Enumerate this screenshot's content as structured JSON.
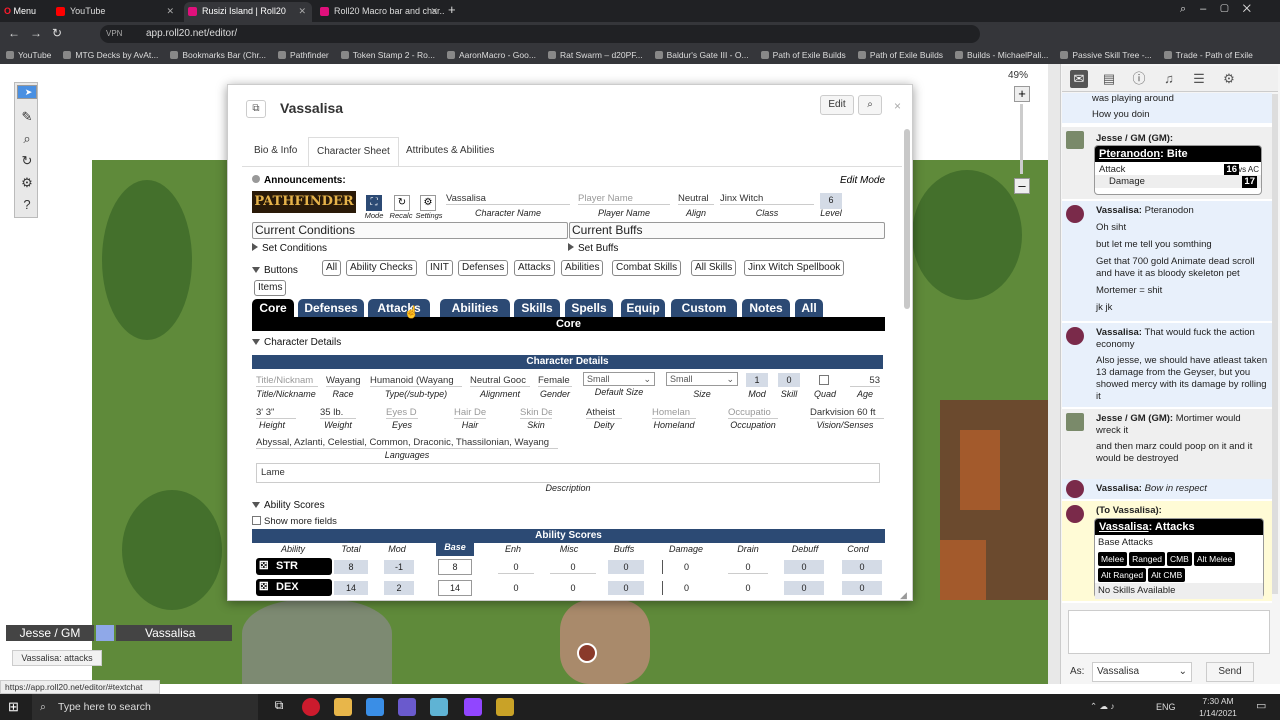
{
  "browser": {
    "menu_label": "Menu",
    "tabs": [
      {
        "label": "YouTube",
        "color": "#ff0000",
        "active": false
      },
      {
        "label": "Rusizi Island | Roll20",
        "color": "#e0107c",
        "active": true
      },
      {
        "label": "Roll20 Macro bar and char...",
        "color": "#e0107c",
        "active": false
      }
    ],
    "url": "app.roll20.net/editor/",
    "vpn_label": "VPN",
    "bookmarks": [
      "YouTube",
      "MTG Decks by AvAt...",
      "Bookmarks Bar (Chr...",
      "Pathfinder",
      "Token Stamp 2 - Ro...",
      "AaronMacro - Goo...",
      "Rat Swarm – d20PF...",
      "Baldur's Gate III - O...",
      "Path of Exile Builds",
      "Path of Exile Builds",
      "Builds - MichaelPali...",
      "Passive Skill Tree -...",
      "Trade - Path of Exile"
    ],
    "zoom": "49%",
    "status_url": "https://app.roll20.net/editor/#textchat"
  },
  "dialog": {
    "title": "Vassalisa",
    "edit_label": "Edit",
    "sheet_tabs": [
      "Bio & Info",
      "Character Sheet",
      "Attributes & Abilities"
    ],
    "announcements_label": "Announcements:",
    "edit_mode_label": "Edit Mode",
    "logo_text": "PATHFINDER",
    "icon_labels": {
      "mode": "Mode",
      "recalc": "Recalc",
      "settings": "Settings"
    },
    "header_fields": {
      "character_name": "Vassalisa",
      "character_name_label": "Character Name",
      "player_name_placeholder": "Player Name",
      "player_name_label": "Player Name",
      "align": "Neutral",
      "align_label": "Align",
      "class": "Jinx Witch",
      "class_label": "Class",
      "level": "6",
      "level_label": "Level"
    },
    "current_conditions": "Current Conditions",
    "current_buffs": "Current Buffs",
    "set_conditions": "Set Conditions",
    "set_buffs": "Set Buffs",
    "buttons_label": "Buttons",
    "buttons": [
      "All",
      "Ability Checks",
      "INIT",
      "Defenses",
      "Attacks",
      "Abilities",
      "Combat Skills",
      "All Skills",
      "Jinx Witch Spellbook",
      "Items"
    ],
    "core_tabs": [
      "Core",
      "Defenses",
      "Attacks",
      "Abilities",
      "Skills",
      "Spells",
      "Equip",
      "Custom",
      "Notes",
      "All"
    ],
    "core_header": "Core",
    "character_details_toggle": "Character Details",
    "character_details_header": "Character Details",
    "details_row1": [
      {
        "value": "Title/Nicknam",
        "label": "Title/Nickname",
        "placeholder": true
      },
      {
        "value": "Wayang",
        "label": "Race"
      },
      {
        "value": "Humanoid (Wayang",
        "label": "Type(/sub-type)"
      },
      {
        "value": "Neutral Gooc",
        "label": "Alignment"
      },
      {
        "value": "Female",
        "label": "Gender"
      }
    ],
    "default_size": {
      "value": "Small",
      "label": "Default Size"
    },
    "size": {
      "value": "Small",
      "label": "Size"
    },
    "mod": {
      "value": "1",
      "label": "Mod"
    },
    "skill": {
      "value": "0",
      "label": "Skill"
    },
    "quad_label": "Quad",
    "age": {
      "value": "53",
      "label": "Age"
    },
    "details_row2": [
      {
        "value": "3' 3\"",
        "label": "Height"
      },
      {
        "value": "35 lb.",
        "label": "Weight"
      },
      {
        "value": "Eyes D",
        "label": "Eyes",
        "placeholder": true
      },
      {
        "value": "Hair De",
        "label": "Hair",
        "placeholder": true
      },
      {
        "value": "Skin De",
        "label": "Skin",
        "placeholder": true
      },
      {
        "value": "Atheist",
        "label": "Deity"
      },
      {
        "value": "Homelan",
        "label": "Homeland",
        "placeholder": true
      },
      {
        "value": "Occupatio",
        "label": "Occupation",
        "placeholder": true
      },
      {
        "value": "Darkvision 60 ft",
        "label": "Vision/Senses"
      }
    ],
    "languages": "Abyssal, Azlanti, Celestial, Common, Draconic, Thassilonian, Wayang",
    "languages_label": "Languages",
    "description": "Lame",
    "description_label": "Description",
    "ability_scores_toggle": "Ability Scores",
    "show_more_fields": "Show more fields",
    "ability_scores_header": "Ability Scores",
    "ability_columns": [
      "Ability",
      "Total",
      "Mod",
      "Base",
      "Enh",
      "Misc",
      "Buffs",
      "Damage",
      "Drain",
      "Debuff",
      "Cond"
    ],
    "abilities": [
      {
        "name": "STR",
        "total": "8",
        "mod": "-1",
        "base": "8",
        "enh": "0",
        "misc": "0",
        "buffs": "0",
        "damage": "0",
        "drain": "0",
        "debuff": "0",
        "cond": "0"
      },
      {
        "name": "DEX",
        "total": "14",
        "mod": "2",
        "base": "14",
        "enh": "0",
        "misc": "0",
        "buffs": "0",
        "damage": "0",
        "drain": "0",
        "debuff": "0",
        "cond": "0"
      }
    ]
  },
  "players": {
    "gm": "Jesse / GM",
    "player": "Vassalisa",
    "tooltip": "Vassalisa: attacks"
  },
  "chat": {
    "msg0_line1": "was playing around",
    "msg0_line2": "How you doin",
    "gm_who": "Jesse / GM (GM):",
    "roll1": {
      "title": "Pteranodon",
      "subtitle": ": Bite",
      "attack_label": "Attack",
      "attack_value": "16",
      "vs": "vs AC",
      "damage_label": "Damage",
      "damage_value": "17"
    },
    "vass_who": "Vassalisa:",
    "vass1": "Pteranodon",
    "vass_lines": [
      "Oh siht",
      "but let me tell you somthing",
      "Get that 700 gold Animate dead scroll and have it as bloody skeleton pet",
      "Mortemer = shit",
      "jk jk"
    ],
    "vass2_first": "That would fuck the action economy",
    "vass2_line": "Also jesse, we should have atleast taken 13 damage from the Geyser, but you showed mercy with its damage by rolling it",
    "gm2_text": "Mortimer would wreck it",
    "gm2_line": "and then marz could poop on it and it would be destroyed",
    "vass3": "Bow in respect",
    "to_who": "(To Vassalisa):",
    "roll2": {
      "title": "Vassalisa",
      "subtitle": ": Attacks",
      "base": "Base Attacks",
      "buttons": [
        "Melee",
        "Ranged",
        "CMB",
        "Alt Melee",
        "Alt Ranged",
        "Alt CMB"
      ],
      "none": "No Skills Available"
    },
    "as_label": "As:",
    "as_value": "Vassalisa",
    "send": "Send"
  },
  "taskbar": {
    "search": "Type here to search",
    "lang": "ENG",
    "time": "7:30 AM",
    "date": "1/14/2021"
  }
}
